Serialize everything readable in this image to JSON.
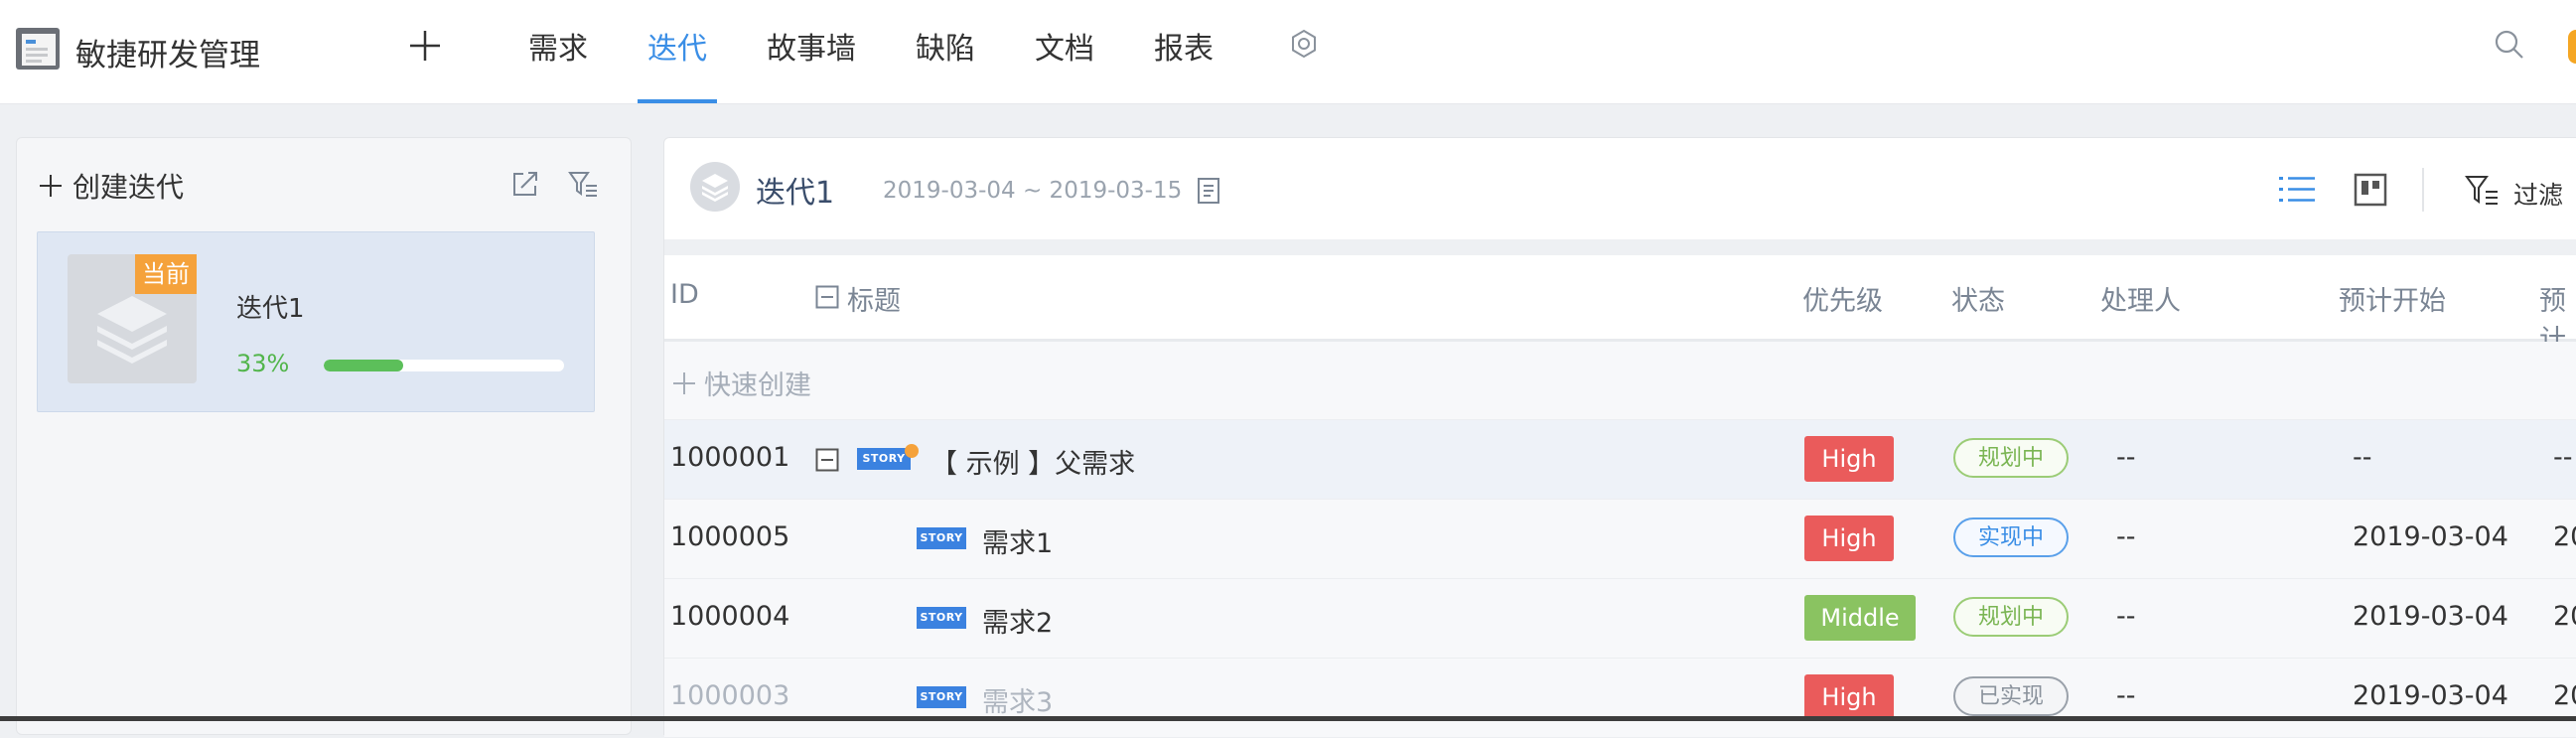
{
  "app": {
    "title": "敏捷研发管理"
  },
  "nav": {
    "items": [
      {
        "label": "需求",
        "active": false
      },
      {
        "label": "迭代",
        "active": true
      },
      {
        "label": "故事墙",
        "active": false
      },
      {
        "label": "缺陷",
        "active": false
      },
      {
        "label": "文档",
        "active": false
      },
      {
        "label": "报表",
        "active": false
      }
    ]
  },
  "sidebar": {
    "create_label": "创建迭代",
    "iteration": {
      "badge": "当前",
      "name": "迭代1",
      "progress_label": "33%",
      "progress": 0.33
    }
  },
  "iteration_header": {
    "name": "迭代1",
    "dates": "2019-03-04 ~ 2019-03-15",
    "filter_label": "过滤"
  },
  "table": {
    "columns": {
      "id": "ID",
      "title": "标题",
      "priority": "优先级",
      "status": "状态",
      "assignee": "处理人",
      "planned_start": "预计开始",
      "planned_end": "预计"
    },
    "quick_create": "快速创建",
    "story_tag": "STORY",
    "rows": [
      {
        "id": "1000001",
        "title": "【 示例 】父需求",
        "priority": "High",
        "status": "规划中",
        "assignee": "--",
        "start": "--",
        "end": "--"
      },
      {
        "id": "1000005",
        "title": "需求1",
        "priority": "High",
        "status": "实现中",
        "assignee": "--",
        "start": "2019-03-04",
        "end": "20"
      },
      {
        "id": "1000004",
        "title": "需求2",
        "priority": "Middle",
        "status": "规划中",
        "assignee": "--",
        "start": "2019-03-04",
        "end": "20"
      },
      {
        "id": "1000003",
        "title": "需求3",
        "priority": "High",
        "status": "已实现",
        "assignee": "--",
        "start": "2019-03-04",
        "end": "20"
      }
    ]
  },
  "colors": {
    "accent": "#3a8ee6",
    "high": "#ea5b5b",
    "middle": "#8ac361",
    "badge": "#f5a23b",
    "progress": "#5cbf5a"
  }
}
